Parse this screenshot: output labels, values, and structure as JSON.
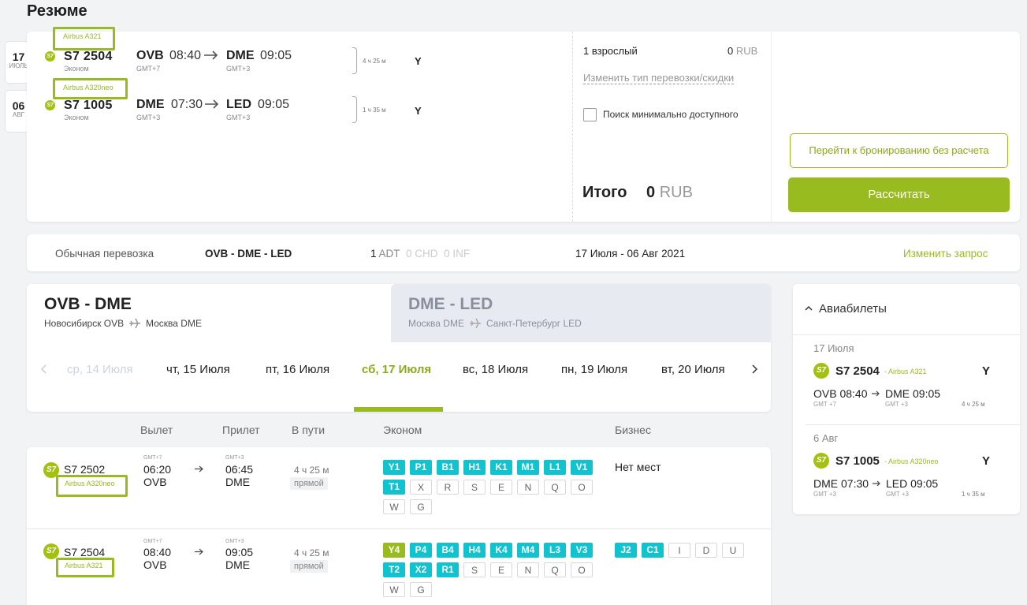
{
  "summary": {
    "title": "Резюме"
  },
  "date_tabs": [
    {
      "day": "17",
      "month": "ИЮЛЬ"
    },
    {
      "day": "06",
      "month": "АВГ"
    }
  ],
  "itinerary": [
    {
      "aircraft": "Airbus A321",
      "flight": "S7  2504",
      "cabin": "Эконом",
      "from": "OVB",
      "dep": "08:40",
      "from_tz": "GMT+7",
      "to": "DME",
      "arr": "09:05",
      "to_tz": "GMT+3",
      "duration": "4 ч 25 м",
      "class": "Y"
    },
    {
      "aircraft": "Airbus A320neo",
      "flight": "S7  1005",
      "cabin": "Эконом",
      "from": "DME",
      "dep": "07:30",
      "from_tz": "GMT+3",
      "to": "LED",
      "arr": "09:05",
      "to_tz": "GMT+3",
      "duration": "1 ч 35 м",
      "class": "Y"
    }
  ],
  "pricing": {
    "passengers": "1 взрослый",
    "amount": "0",
    "currency": "RUB",
    "change_type": "Изменить тип перевозки/скидки",
    "min_search": "Поиск минимально доступного",
    "total_label": "Итого",
    "total_amount": "0",
    "total_currency": "RUB"
  },
  "actions": {
    "book_without_calc": "Перейти к бронированию без расчета",
    "calculate": "Рассчитать"
  },
  "info_bar": {
    "type": "Обычная перевозка",
    "route": "OVB - DME - LED",
    "adt_n": "1",
    "adt": "ADT",
    "chd": "0 CHD",
    "inf": "0 INF",
    "dates": "17 Июля - 06 Авг 2021",
    "change": "Изменить запрос"
  },
  "route_tabs": [
    {
      "title": "OVB - DME",
      "from": "Новосибирск OVB",
      "to": "Москва DME"
    },
    {
      "title": "DME - LED",
      "from": "Москва DME",
      "to": "Санкт-Петербург LED"
    }
  ],
  "date_strip": [
    "ср, 14 Июля",
    "чт, 15 Июля",
    "пт, 16 Июля",
    "сб, 17 Июля",
    "вс, 18 Июля",
    "пн, 19 Июля",
    "вт, 20 Июля"
  ],
  "table_headers": {
    "dep": "Вылет",
    "arr": "Прилет",
    "duration": "В пути",
    "economy": "Эконом",
    "business": "Бизнес"
  },
  "flights": [
    {
      "flight": "S7 2502",
      "aircraft": "Airbus A320neo",
      "dep_tz": "GMT+7",
      "dep_time": "06:20",
      "dep_ap": "OVB",
      "arr_tz": "GMT+3",
      "arr_time": "06:45",
      "arr_ap": "DME",
      "duration": "4 ч 25 м",
      "stops": "прямой",
      "economy": [
        [
          "Y1",
          "on"
        ],
        [
          "P1",
          "on"
        ],
        [
          "B1",
          "on"
        ],
        [
          "H1",
          "on"
        ],
        [
          "K1",
          "on"
        ],
        [
          "M1",
          "on"
        ],
        [
          "L1",
          "on"
        ],
        [
          "V1",
          "on"
        ],
        [
          "T1",
          "on"
        ],
        [
          "X",
          "off"
        ],
        [
          "R",
          "off"
        ],
        [
          "S",
          "off"
        ],
        [
          "E",
          "off"
        ],
        [
          "N",
          "off"
        ],
        [
          "Q",
          "off"
        ],
        [
          "O",
          "off"
        ],
        [
          "W",
          "off"
        ],
        [
          "G",
          "off"
        ]
      ],
      "business_text": "Нет мест",
      "business": []
    },
    {
      "flight": "S7 2504",
      "aircraft": "Airbus A321",
      "dep_tz": "GMT+7",
      "dep_time": "08:40",
      "dep_ap": "OVB",
      "arr_tz": "GMT+3",
      "arr_time": "09:05",
      "arr_ap": "DME",
      "duration": "4 ч 25 м",
      "stops": "прямой",
      "economy": [
        [
          "Y4",
          "yel"
        ],
        [
          "P4",
          "on"
        ],
        [
          "B4",
          "on"
        ],
        [
          "H4",
          "on"
        ],
        [
          "K4",
          "on"
        ],
        [
          "M4",
          "on"
        ],
        [
          "L3",
          "on"
        ],
        [
          "V3",
          "on"
        ],
        [
          "T2",
          "on"
        ],
        [
          "X2",
          "on"
        ],
        [
          "R1",
          "on"
        ],
        [
          "S",
          "off"
        ],
        [
          "E",
          "off"
        ],
        [
          "N",
          "off"
        ],
        [
          "Q",
          "off"
        ],
        [
          "O",
          "off"
        ],
        [
          "W",
          "off"
        ],
        [
          "G",
          "off"
        ]
      ],
      "business_text": "",
      "business": [
        [
          "J2",
          "on"
        ],
        [
          "C1",
          "on"
        ],
        [
          "I",
          "off"
        ],
        [
          "D",
          "off"
        ],
        [
          "U",
          "off"
        ]
      ]
    }
  ],
  "sidebar": {
    "title": "Авиабилеты",
    "segments": [
      {
        "date": "17 Июля",
        "flight": "S7 2504",
        "aircraft": "- Airbus A321",
        "class": "Y",
        "dep": "OVB 08:40",
        "arr": "DME 09:05",
        "dep_tz": "GMT +7",
        "arr_tz": "GMT +3",
        "duration": "4 ч 25 м"
      },
      {
        "date": "6 Авг",
        "flight": "S7 1005",
        "aircraft": "- Airbus A320neo",
        "class": "Y",
        "dep": "DME 07:30",
        "arr": "LED 09:05",
        "dep_tz": "GMT +3",
        "arr_tz": "GMT +3",
        "duration": "1 ч 35 м"
      }
    ]
  },
  "logo_text": "S7",
  "colors": {
    "accent": "#98bb20",
    "seat": "#10c3cf"
  }
}
